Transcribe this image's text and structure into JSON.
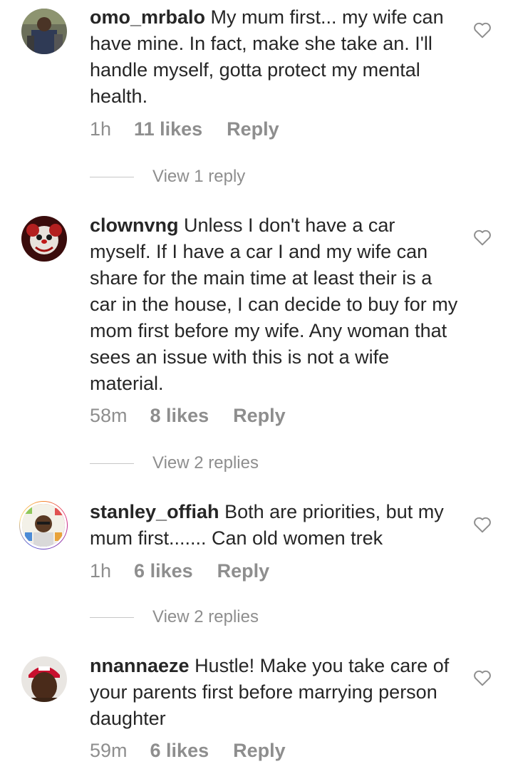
{
  "comments": [
    {
      "username": "omo_mrbalo",
      "text": "My mum first... my wife can have mine. In fact, make she take an. I'll handle myself, gotta protect my mental health.",
      "time": "1h",
      "likes": "11 likes",
      "reply": "Reply",
      "view_replies": "View 1 reply"
    },
    {
      "username": "clownvng",
      "text": "Unless I don't have a car myself. If I have a car I and my wife can share for the main time at least their is a car in the house, I can decide to buy for my mom first before my wife. Any woman that sees an issue with this is not a wife material.",
      "time": "58m",
      "likes": "8 likes",
      "reply": "Reply",
      "view_replies": "View 2 replies"
    },
    {
      "username": "stanley_offiah",
      "text": "Both are priorities, but my mum first....... Can old women trek",
      "time": "1h",
      "likes": "6 likes",
      "reply": "Reply",
      "view_replies": "View 2 replies"
    },
    {
      "username": "nnannaeze",
      "text": "Hustle! Make you take care of your parents first before marrying person daughter",
      "time": "59m",
      "likes": "6 likes",
      "reply": "Reply"
    }
  ],
  "colors": {
    "text": "#262626",
    "secondary": "#8e8e8e",
    "divider": "#c7c7c7"
  },
  "icons": {
    "like": "heart-outline-icon"
  }
}
